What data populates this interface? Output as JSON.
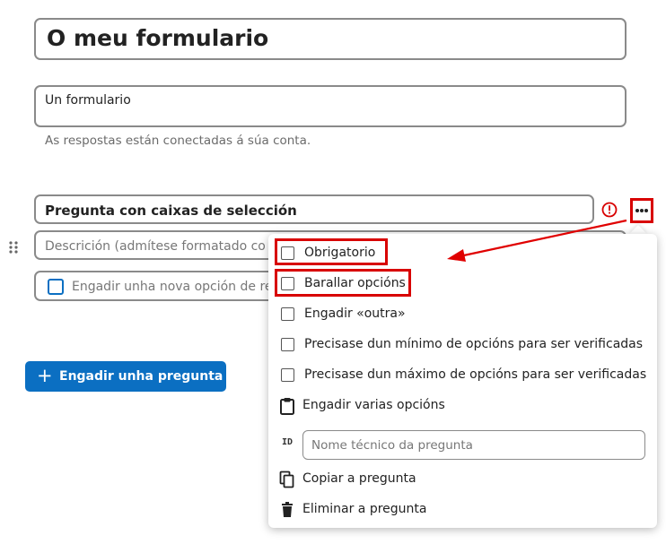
{
  "form": {
    "title": "O meu formulario",
    "description": "Un formulario",
    "connection_note": "As respostas están conectadas á súa conta."
  },
  "question": {
    "title": "Pregunta con caixas de selección",
    "description_placeholder": "Descrición (admítese formatado co",
    "add_option_placeholder": "Engadir unha nova opción de re"
  },
  "add_question_button": {
    "label": "Engadir unha pregunta",
    "icon": "plus-icon"
  },
  "question_menu": {
    "items": [
      {
        "label": "Obrigatorio",
        "type": "checkbox",
        "checked": false
      },
      {
        "label": "Barallar opcións",
        "type": "checkbox",
        "checked": false
      },
      {
        "label": "Engadir «outra»",
        "type": "checkbox",
        "checked": false
      },
      {
        "label": "Precisase dun mínimo de opcións para ser verificadas",
        "type": "checkbox",
        "checked": false
      },
      {
        "label": "Precisase dun máximo de opcións para ser verificadas",
        "type": "checkbox",
        "checked": false
      },
      {
        "label": "Engadir varias opcións",
        "type": "action",
        "icon": "clipboard-icon"
      },
      {
        "label": "Copiar a pregunta",
        "type": "action",
        "icon": "copy-icon"
      },
      {
        "label": "Eliminar a pregunta",
        "type": "action",
        "icon": "trash-icon"
      }
    ],
    "technical_name": {
      "id_label": "ID",
      "placeholder": "Nome técnico da pregunta",
      "value": ""
    }
  },
  "colors": {
    "accent": "#0b6fc2",
    "highlight": "#d80000",
    "warning": "#d80000"
  }
}
